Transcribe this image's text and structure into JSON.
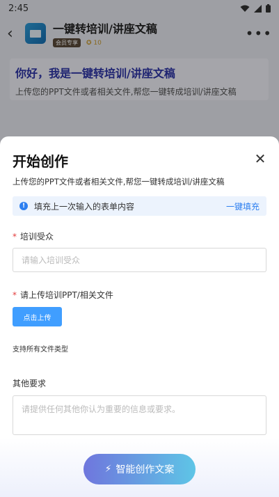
{
  "status_bar": {
    "time": "2:45"
  },
  "header": {
    "back_icon": "‹",
    "title": "一键转培训/讲座文稿",
    "badge": "会员专享",
    "score": "✪ 10",
    "more_icon": "•••"
  },
  "intro": {
    "title": "你好，我是一键转培训/讲座文稿",
    "subtitle": "上传您的PPT文件或者相关文件,帮您一键转成培训/讲座文稿"
  },
  "sheet": {
    "title": "开始创作",
    "close_icon": "✕",
    "subtitle": "上传您的PPT文件或者相关文件,帮您一键转成培训/讲座文稿",
    "tip": {
      "icon": "!",
      "text": "填充上一次输入的表单内容",
      "action": "一键填充"
    },
    "audience": {
      "required_mark": "*",
      "label": "培训受众",
      "placeholder": "请输入培训受众"
    },
    "upload": {
      "required_mark": "*",
      "label": "请上传培训PPT/相关文件",
      "button": "点击上传",
      "hint": "支持所有文件类型"
    },
    "other": {
      "label": "其他要求",
      "placeholder": "请提供任何其他你认为重要的信息或要求。"
    },
    "submit": {
      "icon": "⚡",
      "label": "智能创作文案"
    }
  },
  "colors": {
    "accent": "#409eff",
    "link": "#2d7ff0",
    "required": "#e23c3c"
  }
}
